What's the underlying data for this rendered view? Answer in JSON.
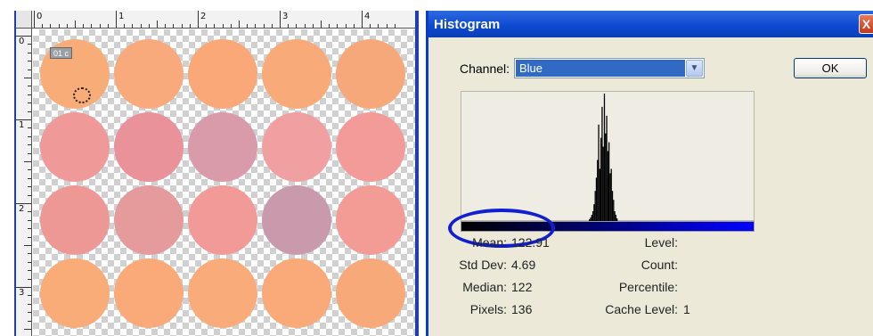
{
  "canvas": {
    "ruler_marks": [
      "0",
      "1",
      "2",
      "3",
      "4"
    ],
    "vertical_marks": [
      "0",
      "1",
      "2",
      "3"
    ],
    "sample_badge": "01 c",
    "well_colors": [
      [
        "#f8ad78",
        "#f9aa7c",
        "#faa878",
        "#f8aa78",
        "#f7a87a"
      ],
      [
        "#ef9a98",
        "#e9929a",
        "#d99aaa",
        "#f0a0a0",
        "#f29b98"
      ],
      [
        "#ee9896",
        "#e59a9c",
        "#f19a97",
        "#c99aac",
        "#f39c96"
      ],
      [
        "#f9ab78",
        "#faa979",
        "#f9ac7a",
        "#f9aa78",
        "#f8a979"
      ]
    ]
  },
  "dialog": {
    "title": "Histogram",
    "close_glyph": "X",
    "channel_label": "Channel:",
    "channel_value": "Blue",
    "dropdown_glyph": "▼",
    "ok_label": "OK",
    "stats": {
      "mean_label": "Mean:",
      "mean_value": "122.91",
      "stddev_label": "Std Dev:",
      "stddev_value": "4.69",
      "median_label": "Median:",
      "median_value": "122",
      "pixels_label": "Pixels:",
      "pixels_value": "136",
      "level_label": "Level:",
      "count_label": "Count:",
      "percentile_label": "Percentile:",
      "cache_label": "Cache Level:",
      "cache_value": "1"
    }
  },
  "chart_data": {
    "type": "bar",
    "x": [
      111,
      112,
      113,
      114,
      115,
      116,
      117,
      118,
      119,
      120,
      121,
      122,
      123,
      124,
      125,
      126,
      127,
      128,
      129,
      130,
      131,
      132,
      133,
      134,
      135
    ],
    "values": [
      3,
      5,
      8,
      12,
      20,
      35,
      50,
      70,
      110,
      60,
      95,
      130,
      85,
      145,
      100,
      120,
      80,
      90,
      55,
      60,
      35,
      25,
      12,
      8,
      4
    ],
    "xlim": [
      0,
      255
    ],
    "ylim": [
      0,
      145
    ],
    "grid": false
  }
}
